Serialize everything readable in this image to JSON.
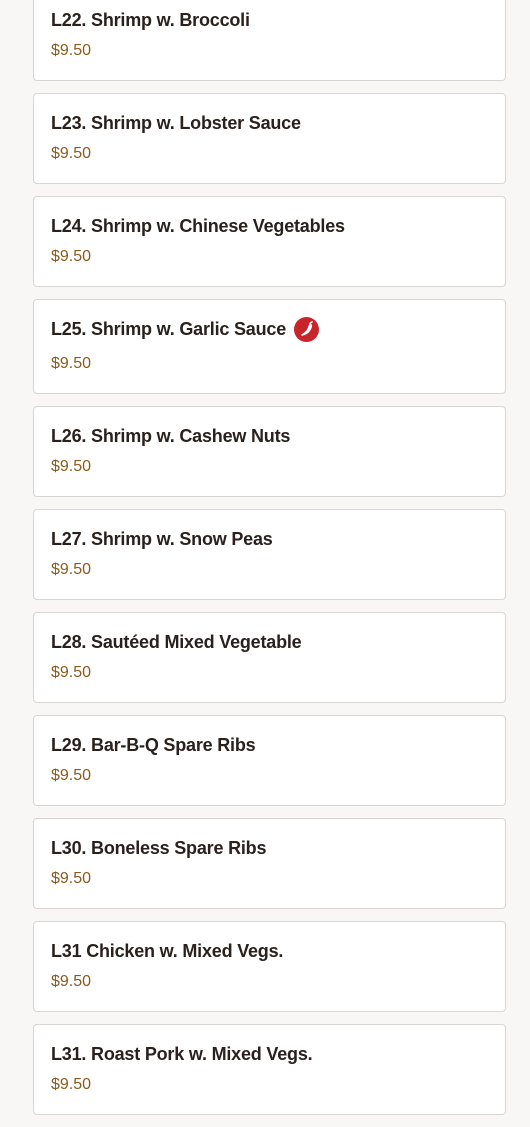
{
  "menu": {
    "items": [
      {
        "name": "L22. Shrimp w. Broccoli",
        "price": "$9.50",
        "spicy": false
      },
      {
        "name": "L23. Shrimp w. Lobster Sauce",
        "price": "$9.50",
        "spicy": false
      },
      {
        "name": "L24. Shrimp w. Chinese Vegetables",
        "price": "$9.50",
        "spicy": false
      },
      {
        "name": "L25. Shrimp w. Garlic Sauce",
        "price": "$9.50",
        "spicy": true,
        "spicy_icon": "chili-pepper-icon"
      },
      {
        "name": "L26. Shrimp w. Cashew Nuts",
        "price": "$9.50",
        "spicy": false
      },
      {
        "name": "L27. Shrimp w. Snow Peas",
        "price": "$9.50",
        "spicy": false
      },
      {
        "name": "L28. Sautéed Mixed Vegetable",
        "price": "$9.50",
        "spicy": false
      },
      {
        "name": "L29. Bar-B-Q Spare Ribs",
        "price": "$9.50",
        "spicy": false
      },
      {
        "name": "L30. Boneless Spare Ribs",
        "price": "$9.50",
        "spicy": false
      },
      {
        "name": "L31 Chicken w. Mixed Vegs.",
        "price": "$9.50",
        "spicy": false
      },
      {
        "name": "L31. Roast Pork w. Mixed Vegs.",
        "price": "$9.50",
        "spicy": false
      }
    ]
  },
  "colors": {
    "spicy_badge": "#c8242b",
    "price_text": "#8a5a1e",
    "name_text": "#2a211c"
  }
}
